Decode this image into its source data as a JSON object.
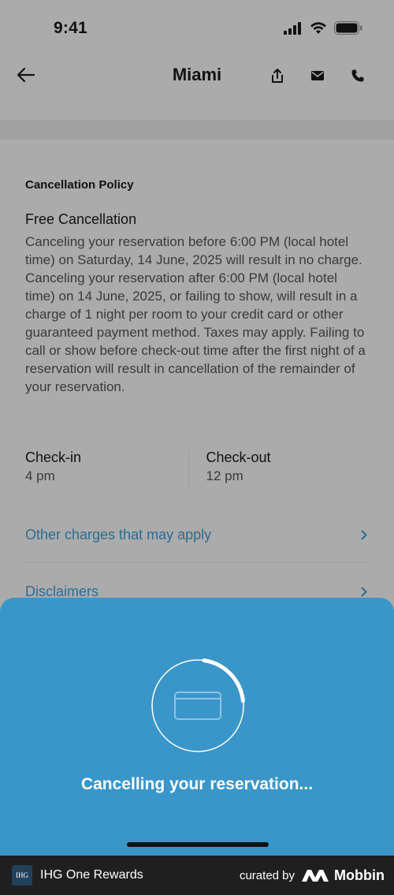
{
  "status_bar": {
    "time": "9:41"
  },
  "nav": {
    "title": "Miami"
  },
  "policy": {
    "section_title": "Cancellation Policy",
    "heading": "Free Cancellation",
    "body": "Canceling your reservation before 6:00 PM (local hotel time) on Saturday, 14 June, 2025 will result in no charge. Canceling your reservation after 6:00 PM (local hotel time) on 14 June, 2025, or failing to show, will result in a charge of 1 night per room to your credit card or other guaranteed payment method. Taxes may apply. Failing to call or show before check-out time after the first night of a reservation will result in cancellation of the remainder of your reservation."
  },
  "checkin": {
    "label": "Check-in",
    "value": "4 pm"
  },
  "checkout": {
    "label": "Check-out",
    "value": "12 pm"
  },
  "links": [
    {
      "label": "Other charges that may apply"
    },
    {
      "label": "Disclaimers"
    }
  ],
  "sheet": {
    "message": "Cancelling your reservation..."
  },
  "footer": {
    "logo_text": "IHG",
    "brand": "IHG One Rewards",
    "curated_by": "curated by",
    "mobbin": "Mobbin"
  },
  "colors": {
    "sheet": "#3a96c9",
    "link": "#2b6c92",
    "overlay_bg": "#ababab"
  }
}
